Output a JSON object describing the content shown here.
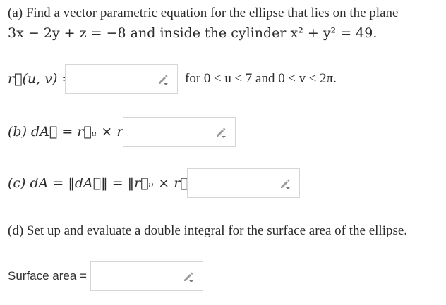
{
  "part_a": {
    "line1": "(a) Find a vector parametric equation for the ellipse that lies on the plane",
    "line2": "3x − 2y + z = −8 and inside the cylinder x² + y² = 49.",
    "lhs": "r⃗(u, v) =",
    "input_value": "",
    "suffix": "for 0 ≤ u ≤ 7 and 0 ≤ v ≤ 2π."
  },
  "part_b": {
    "lhs": "(b) dA⃗ = r⃗ᵤ × r⃗ᵥ =",
    "input_value": ""
  },
  "part_c": {
    "lhs": "(c) dA = ‖dA⃗‖ = ‖r⃗ᵤ × r⃗ᵥ‖ =",
    "input_value": ""
  },
  "part_d": {
    "text": "(d) Set up and evaluate a double integral for the surface area of the ellipse."
  },
  "surface_area": {
    "label": "Surface area =",
    "input_value": ""
  },
  "icons": {
    "answer_box_icon": "pencil-icon"
  }
}
